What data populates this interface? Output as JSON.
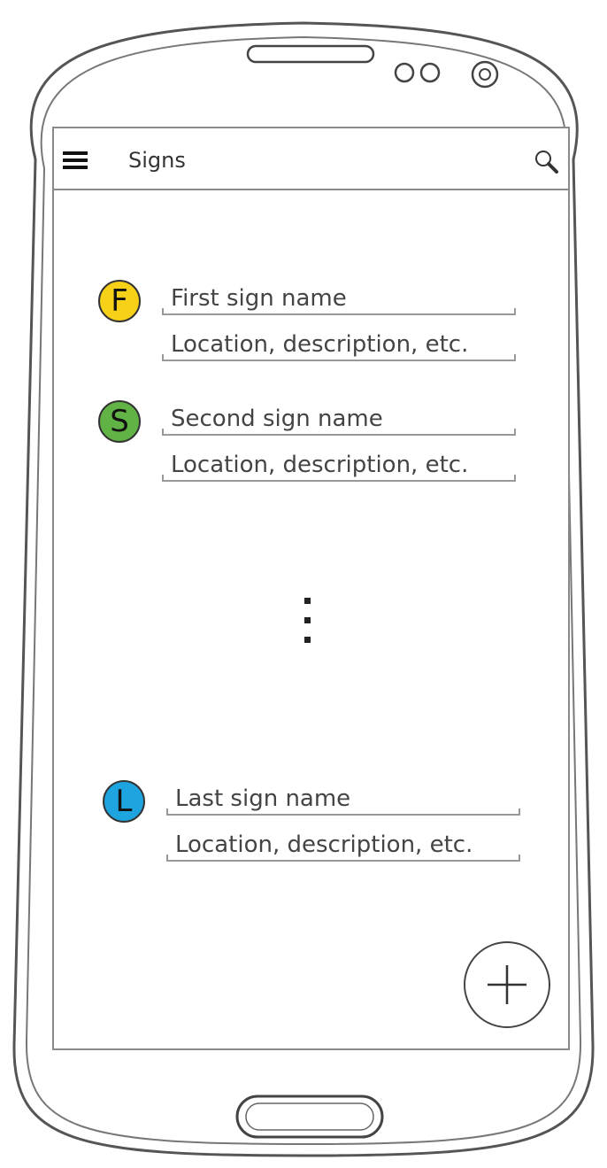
{
  "header": {
    "title": "Signs",
    "menu_icon": "menu-icon",
    "search_icon": "search-icon"
  },
  "signs": [
    {
      "initial": "F",
      "name": "First sign name",
      "details": "Location, description, etc.",
      "color": "#f7d117"
    },
    {
      "initial": "S",
      "name": "Second sign name",
      "details": "Location, description, etc.",
      "color": "#62b346"
    },
    {
      "initial": "L",
      "name": "Last sign name",
      "details": "Location, description, etc.",
      "color": "#1ea5e0"
    }
  ],
  "fab": {
    "icon": "plus-icon"
  }
}
